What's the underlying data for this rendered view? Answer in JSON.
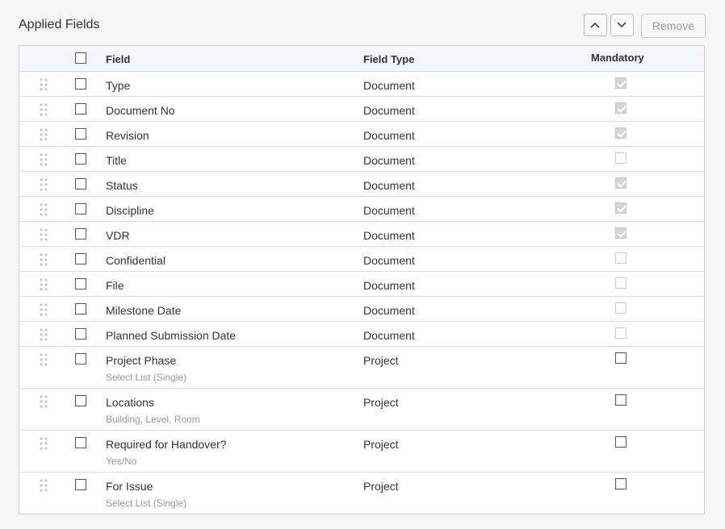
{
  "panel_title": "Applied Fields",
  "toolbar": {
    "move_up_icon": "chevron-up-icon",
    "move_down_icon": "chevron-down-icon",
    "remove_label": "Remove"
  },
  "table": {
    "headers": {
      "field": "Field",
      "field_type": "Field Type",
      "mandatory": "Mandatory"
    },
    "rows": [
      {
        "field": "Type",
        "subtext": "",
        "field_type": "Document",
        "mandatory": "checked-disabled"
      },
      {
        "field": "Document No",
        "subtext": "",
        "field_type": "Document",
        "mandatory": "checked-disabled"
      },
      {
        "field": "Revision",
        "subtext": "",
        "field_type": "Document",
        "mandatory": "checked-disabled"
      },
      {
        "field": "Title",
        "subtext": "",
        "field_type": "Document",
        "mandatory": "unchecked-disabled"
      },
      {
        "field": "Status",
        "subtext": "",
        "field_type": "Document",
        "mandatory": "checked-disabled"
      },
      {
        "field": "Discipline",
        "subtext": "",
        "field_type": "Document",
        "mandatory": "checked-disabled"
      },
      {
        "field": "VDR",
        "subtext": "",
        "field_type": "Document",
        "mandatory": "checked-disabled"
      },
      {
        "field": "Confidential",
        "subtext": "",
        "field_type": "Document",
        "mandatory": "unchecked-disabled"
      },
      {
        "field": "File",
        "subtext": "",
        "field_type": "Document",
        "mandatory": "unchecked-disabled"
      },
      {
        "field": "Milestone Date",
        "subtext": "",
        "field_type": "Document",
        "mandatory": "unchecked-disabled"
      },
      {
        "field": "Planned Submission Date",
        "subtext": "",
        "field_type": "Document",
        "mandatory": "unchecked-disabled"
      },
      {
        "field": "Project Phase",
        "subtext": "Select List (Single)",
        "field_type": "Project",
        "mandatory": "unchecked"
      },
      {
        "field": "Locations",
        "subtext": "Building, Level, Room",
        "field_type": "Project",
        "mandatory": "unchecked"
      },
      {
        "field": "Required for Handover?",
        "subtext": "Yes/No",
        "field_type": "Project",
        "mandatory": "unchecked"
      },
      {
        "field": "For Issue",
        "subtext": "Select List (Single)",
        "field_type": "Project",
        "mandatory": "unchecked"
      }
    ]
  }
}
